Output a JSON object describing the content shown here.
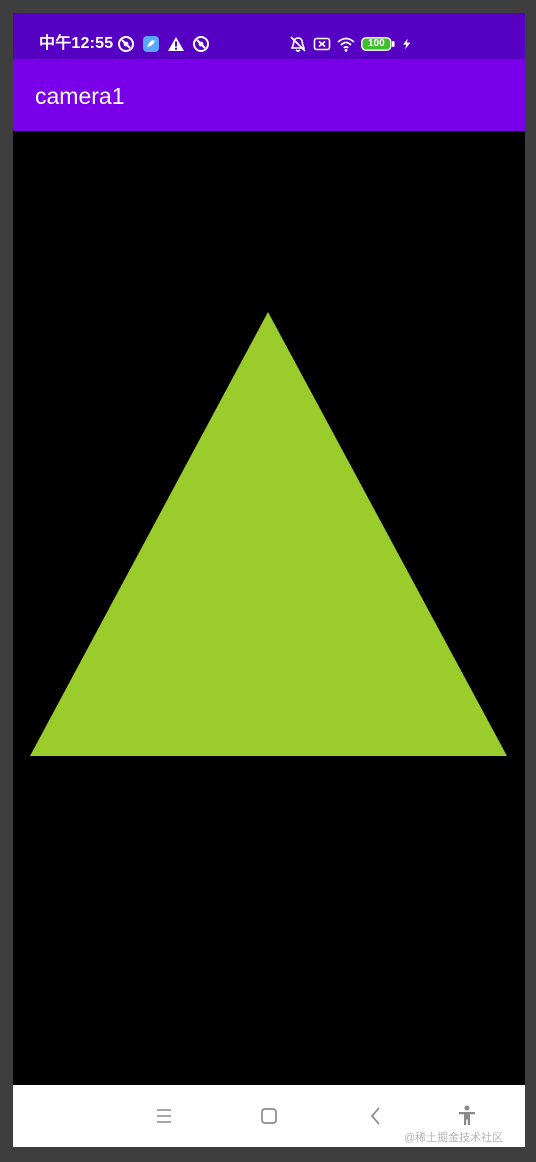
{
  "status_bar": {
    "time": "中午12:55",
    "left_icons": [
      "vpn-lock-icon",
      "app-notification-icon",
      "warning-icon",
      "vpn-lock-icon"
    ],
    "right_icons": [
      "alarm-off-icon",
      "no-sim-icon",
      "wifi-icon",
      "battery-icon",
      "charging-bolt-icon"
    ],
    "battery_level": "100",
    "background": "#5600c4"
  },
  "app_bar": {
    "title": "camera1",
    "background": "#7b00ea"
  },
  "content": {
    "background": "#000000",
    "shape": "triangle",
    "shape_color": "#9acd2b"
  },
  "nav_bar": {
    "buttons": [
      "menu-icon",
      "home-square-icon",
      "back-chevron-icon",
      "accessibility-icon"
    ],
    "background": "#ffffff",
    "icon_color": "#8a8a8a"
  },
  "watermark": "@稀土掘金技术社区"
}
